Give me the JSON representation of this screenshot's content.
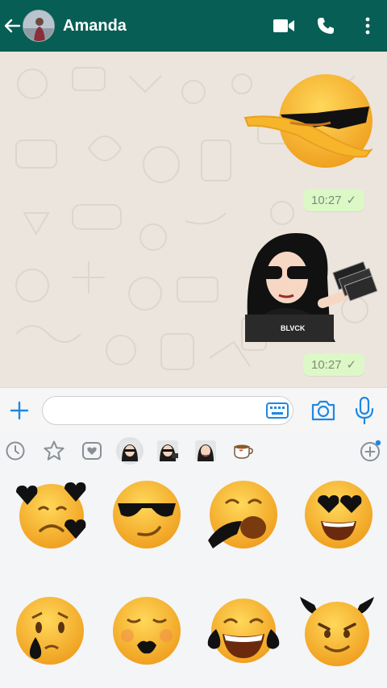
{
  "header": {
    "contact_name": "Amanda",
    "icons": [
      "back-arrow-icon",
      "video-call-icon",
      "phone-icon",
      "more-vertical-icon"
    ],
    "color": "#075e54"
  },
  "chat": {
    "background_color": "#ece5dd",
    "bubble_color": "#dcf8c6",
    "messages": [
      {
        "type": "sticker",
        "sticker": "dabbing-sunglasses-emoji",
        "time": "10:27",
        "status": "✓"
      },
      {
        "type": "sticker",
        "sticker": "girl-holding-money",
        "caption_on_sticker": "BLVCK",
        "time": "10:27",
        "status": "✓"
      }
    ]
  },
  "input_bar": {
    "placeholder": "",
    "icons": [
      "plus-icon",
      "keyboard-icon",
      "camera-icon",
      "microphone-icon"
    ]
  },
  "sticker_tray": {
    "tabs": [
      "recent-clock-icon",
      "favorites-star-icon",
      "heart-pack-icon",
      "pack-girl-1",
      "pack-girl-2",
      "pack-girl-3",
      "pack-coffee-cup",
      "add-pack-icon"
    ],
    "selected_tab": "pack-girl-1",
    "stickers": [
      "broken-hearts-sad-emoji",
      "sunglasses-smirk-emoji",
      "sleeping-drooling-emoji",
      "black-heart-eyes-emoji",
      "crying-teardrop-emoji",
      "black-lips-blushing-emoji",
      "tears-of-joy-emoji",
      "devil-horns-emoji"
    ]
  }
}
